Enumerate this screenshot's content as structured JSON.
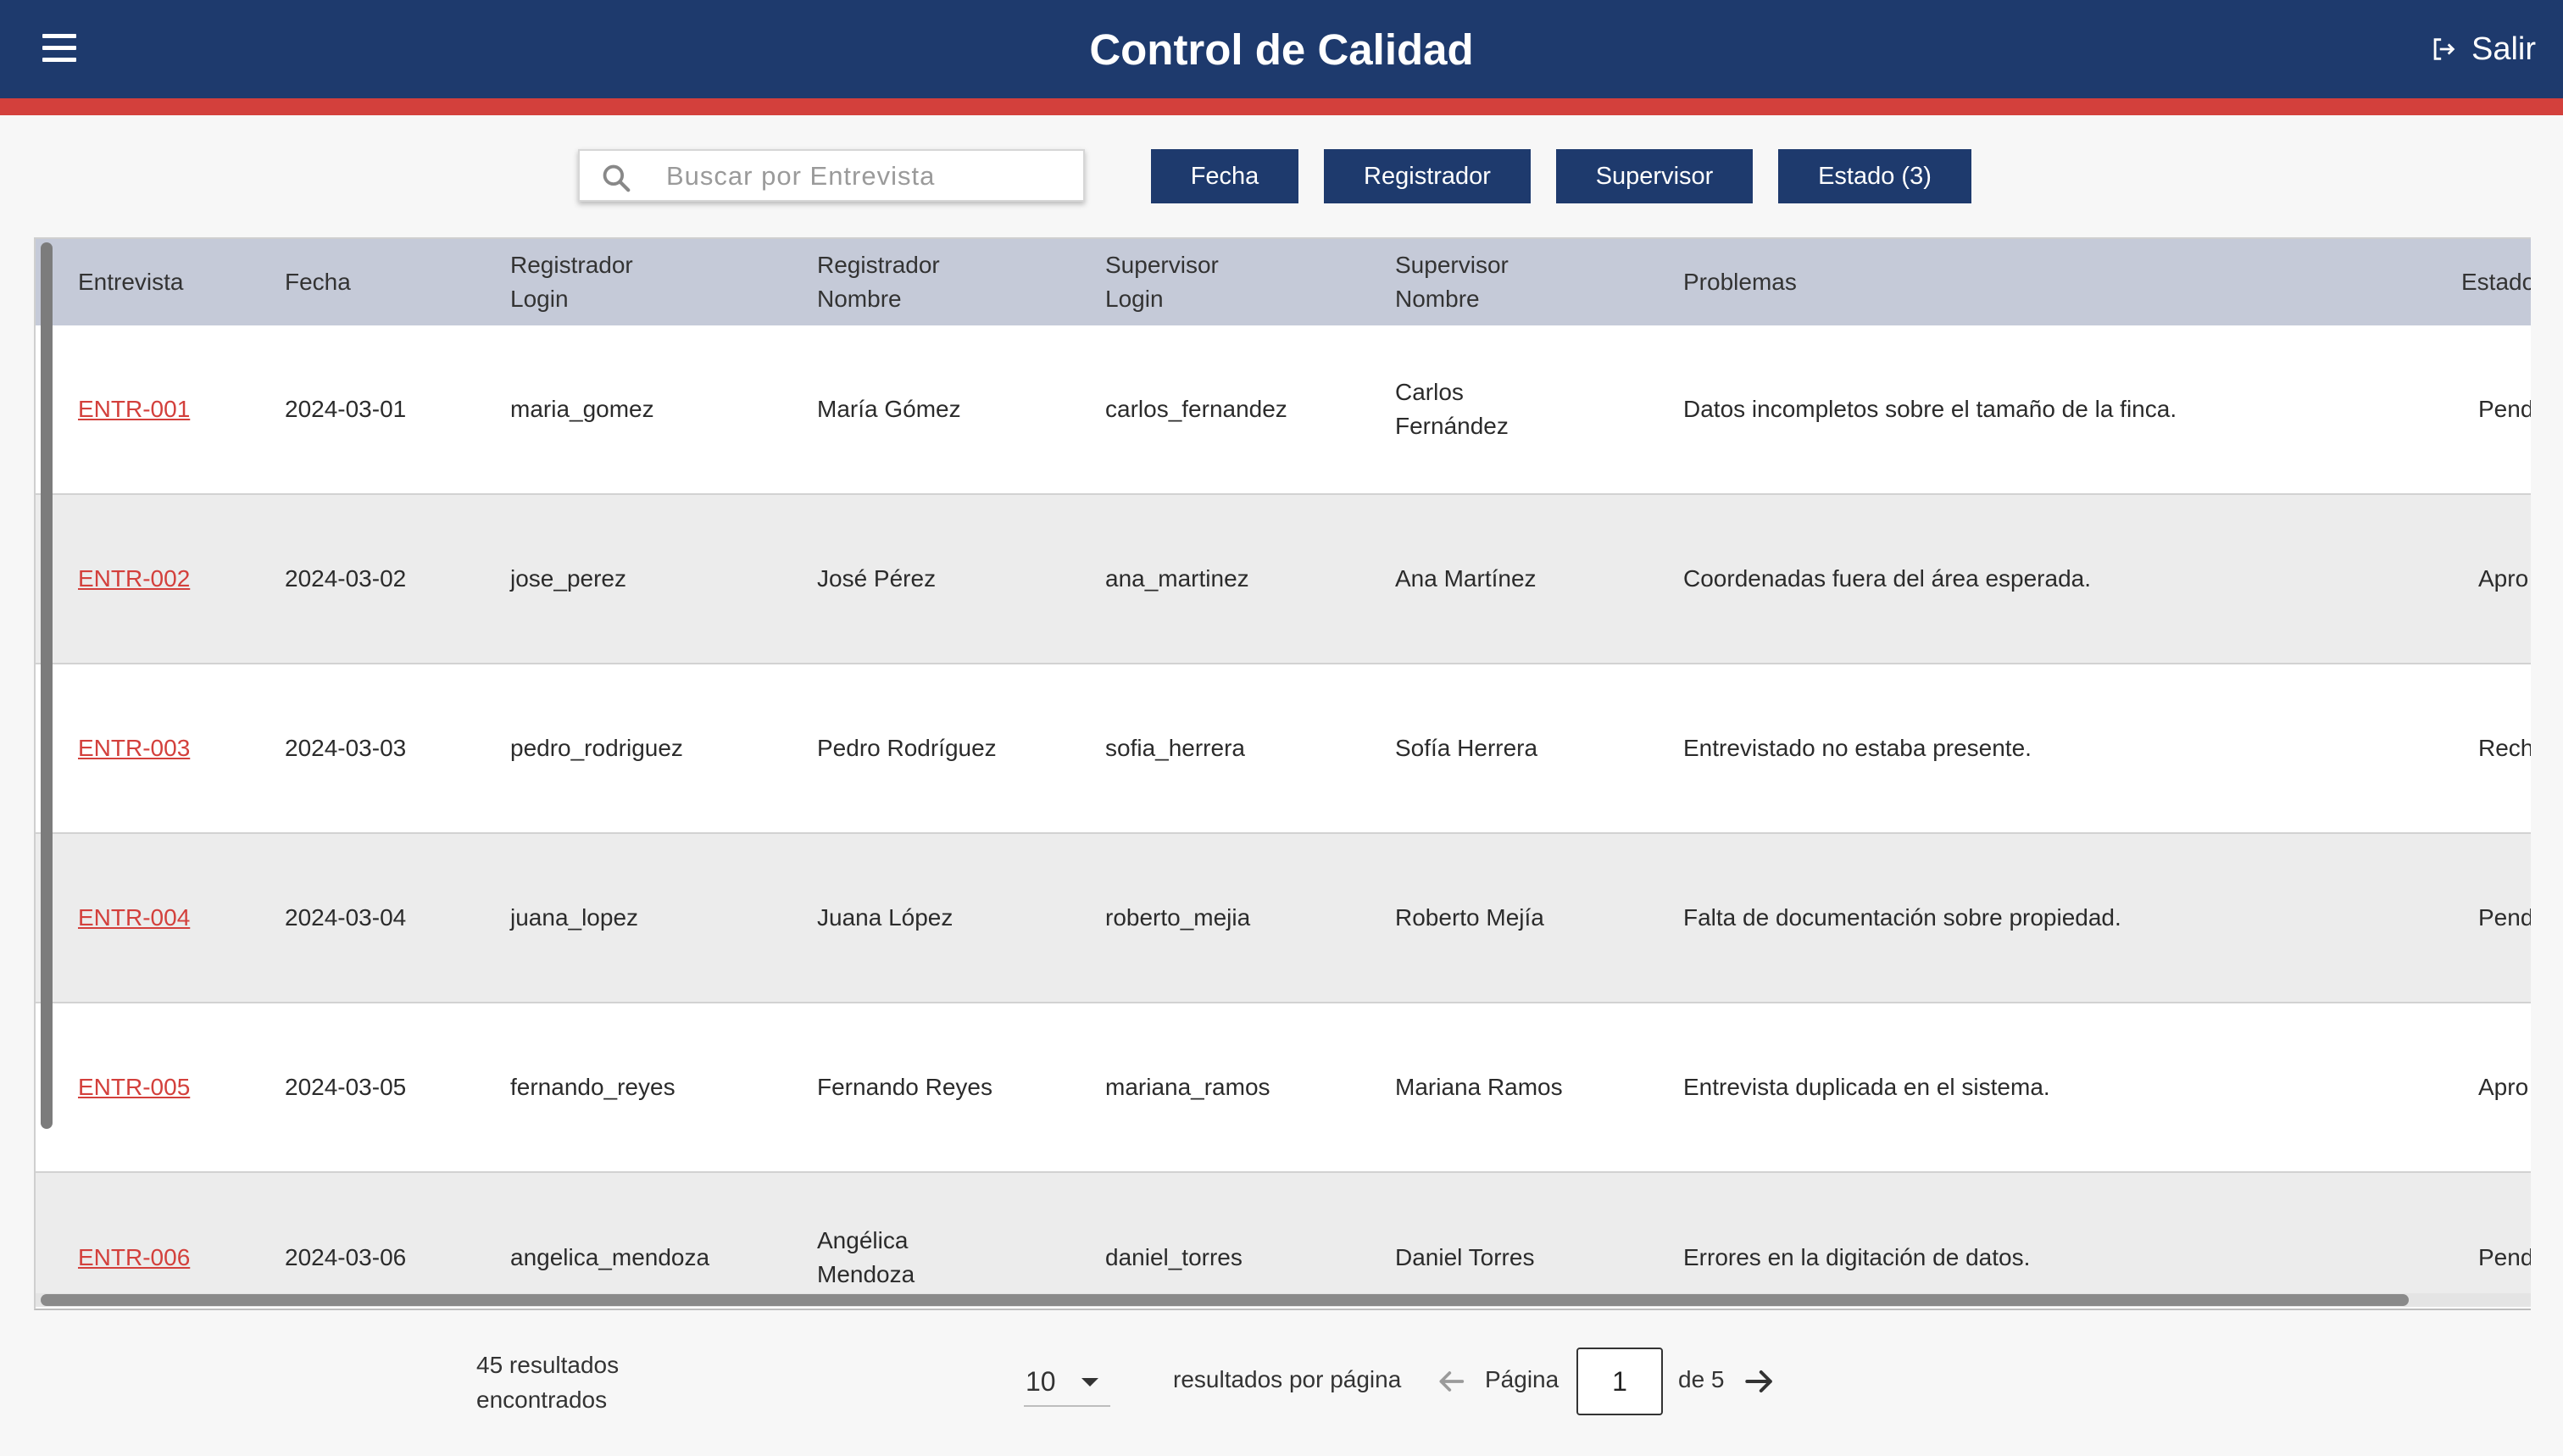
{
  "header": {
    "title": "Control de Calidad",
    "logout_label": "Salir"
  },
  "search": {
    "placeholder": "Buscar por Entrevista",
    "value": ""
  },
  "filters": {
    "fecha": "Fecha",
    "registrador": "Registrador",
    "supervisor": "Supervisor",
    "estado": "Estado (3)"
  },
  "table": {
    "headers": [
      "Entrevista",
      "Fecha",
      "Registrador\nLogin",
      "Registrador\nNombre",
      "Supervisor\nLogin",
      "Supervisor\nNombre",
      "Problemas",
      "Estado"
    ],
    "rows": [
      {
        "entrevista": "ENTR-001",
        "fecha": "2024-03-01",
        "reg_login": "maria_gomez",
        "reg_nombre": "María Gómez",
        "sup_login": "carlos_fernandez",
        "sup_nombre": "Carlos\nFernández",
        "problemas": "Datos incompletos sobre el tamaño de la finca.",
        "estado": "Pend"
      },
      {
        "entrevista": "ENTR-002",
        "fecha": "2024-03-02",
        "reg_login": "jose_perez",
        "reg_nombre": "José Pérez",
        "sup_login": "ana_martinez",
        "sup_nombre": "Ana Martínez",
        "problemas": "Coordenadas fuera del área esperada.",
        "estado": "Apro"
      },
      {
        "entrevista": "ENTR-003",
        "fecha": "2024-03-03",
        "reg_login": "pedro_rodriguez",
        "reg_nombre": "Pedro Rodríguez",
        "sup_login": "sofia_herrera",
        "sup_nombre": "Sofía Herrera",
        "problemas": "Entrevistado no estaba presente.",
        "estado": "Rech"
      },
      {
        "entrevista": "ENTR-004",
        "fecha": "2024-03-04",
        "reg_login": "juana_lopez",
        "reg_nombre": "Juana López",
        "sup_login": "roberto_mejia",
        "sup_nombre": "Roberto Mejía",
        "problemas": "Falta de documentación sobre propiedad.",
        "estado": "Pend"
      },
      {
        "entrevista": "ENTR-005",
        "fecha": "2024-03-05",
        "reg_login": "fernando_reyes",
        "reg_nombre": "Fernando Reyes",
        "sup_login": "mariana_ramos",
        "sup_nombre": "Mariana Ramos",
        "problemas": "Entrevista duplicada en el sistema.",
        "estado": "Apro"
      },
      {
        "entrevista": "ENTR-006",
        "fecha": "2024-03-06",
        "reg_login": "angelica_mendoza",
        "reg_nombre": "Angélica\nMendoza",
        "sup_login": "daniel_torres",
        "sup_nombre": "Daniel Torres",
        "problemas": "Errores en la digitación de datos.",
        "estado": "Pend"
      }
    ]
  },
  "footer": {
    "results": "45 resultados\nencontrados",
    "per_page_value": "10",
    "per_page_label": "resultados por página",
    "page_label": "Página",
    "current_page": "1",
    "of_label": "de 5"
  },
  "colors": {
    "header_bg": "#1e3a6d",
    "accent": "#d3403c",
    "table_header_bg": "#c5cad8",
    "row_alt": "#ececec",
    "link": "#d3403c"
  },
  "icons": {
    "menu": "hamburger-menu-icon",
    "logout": "logout-icon",
    "search": "search-icon",
    "prev": "arrow-left-icon",
    "next": "arrow-right-icon",
    "dropdown": "caret-down-icon"
  }
}
